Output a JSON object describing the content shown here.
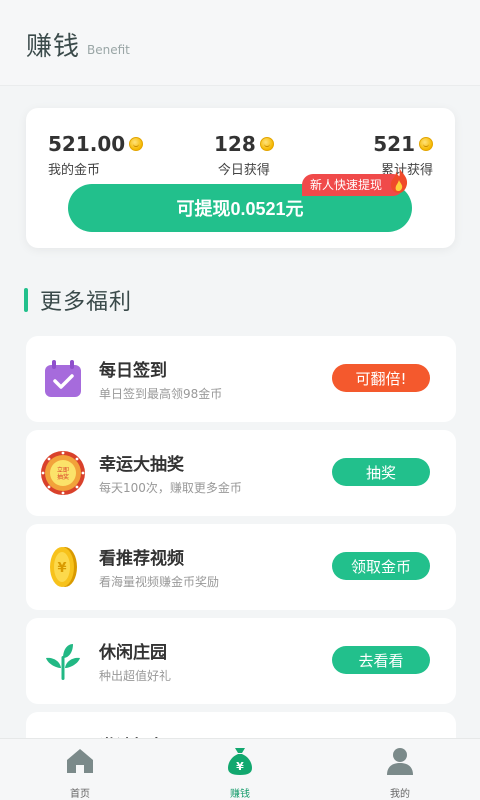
{
  "header": {
    "title": "赚钱",
    "subtitle": "Benefit"
  },
  "stats": {
    "coins": {
      "value": "521.00",
      "label": "我的金币"
    },
    "today": {
      "value": "128",
      "label": "今日获得"
    },
    "total": {
      "value": "521",
      "label": "累计获得"
    }
  },
  "withdraw": {
    "label": "可提现0.0521元",
    "badge": "新人快速提现"
  },
  "section": {
    "title": "更多福利"
  },
  "tasks": [
    {
      "title": "每日签到",
      "desc": "单日签到最高领98金币",
      "button": "可翻倍!"
    },
    {
      "title": "幸运大抽奖",
      "desc": "每天100次，赚取更多金币",
      "button": "抽奖",
      "icon_text": "立即抽奖"
    },
    {
      "title": "看推荐视频",
      "desc": "看海量视频赚金币奖励",
      "button": "领取金币"
    },
    {
      "title": "休闲庄园",
      "desc": "种出超值好礼",
      "button": "去看看"
    },
    {
      "title": "邀请好友",
      "desc": "",
      "button": ""
    }
  ],
  "tabbar": {
    "home": "首页",
    "earn": "赚钱",
    "mine": "我的"
  },
  "colors": {
    "accent": "#22c08c",
    "orange": "#f4592d",
    "badge": "#f04a4a"
  }
}
